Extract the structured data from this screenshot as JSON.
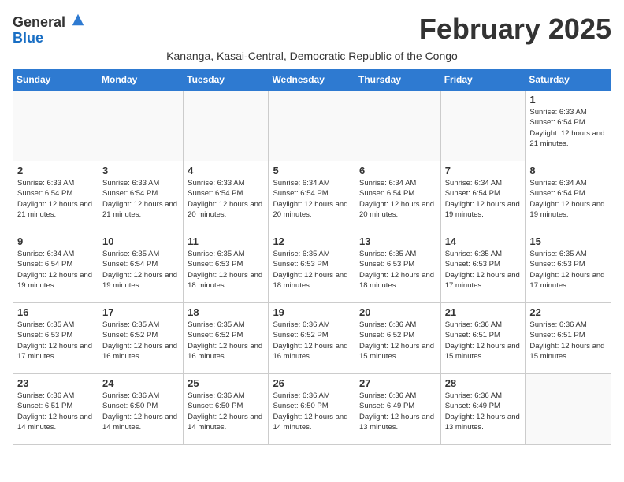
{
  "logo": {
    "general": "General",
    "blue": "Blue"
  },
  "header": {
    "month": "February 2025",
    "location": "Kananga, Kasai-Central, Democratic Republic of the Congo"
  },
  "days_of_week": [
    "Sunday",
    "Monday",
    "Tuesday",
    "Wednesday",
    "Thursday",
    "Friday",
    "Saturday"
  ],
  "weeks": [
    [
      {
        "day": "",
        "info": ""
      },
      {
        "day": "",
        "info": ""
      },
      {
        "day": "",
        "info": ""
      },
      {
        "day": "",
        "info": ""
      },
      {
        "day": "",
        "info": ""
      },
      {
        "day": "",
        "info": ""
      },
      {
        "day": "1",
        "info": "Sunrise: 6:33 AM\nSunset: 6:54 PM\nDaylight: 12 hours and 21 minutes."
      }
    ],
    [
      {
        "day": "2",
        "info": "Sunrise: 6:33 AM\nSunset: 6:54 PM\nDaylight: 12 hours and 21 minutes."
      },
      {
        "day": "3",
        "info": "Sunrise: 6:33 AM\nSunset: 6:54 PM\nDaylight: 12 hours and 21 minutes."
      },
      {
        "day": "4",
        "info": "Sunrise: 6:33 AM\nSunset: 6:54 PM\nDaylight: 12 hours and 20 minutes."
      },
      {
        "day": "5",
        "info": "Sunrise: 6:34 AM\nSunset: 6:54 PM\nDaylight: 12 hours and 20 minutes."
      },
      {
        "day": "6",
        "info": "Sunrise: 6:34 AM\nSunset: 6:54 PM\nDaylight: 12 hours and 20 minutes."
      },
      {
        "day": "7",
        "info": "Sunrise: 6:34 AM\nSunset: 6:54 PM\nDaylight: 12 hours and 19 minutes."
      },
      {
        "day": "8",
        "info": "Sunrise: 6:34 AM\nSunset: 6:54 PM\nDaylight: 12 hours and 19 minutes."
      }
    ],
    [
      {
        "day": "9",
        "info": "Sunrise: 6:34 AM\nSunset: 6:54 PM\nDaylight: 12 hours and 19 minutes."
      },
      {
        "day": "10",
        "info": "Sunrise: 6:35 AM\nSunset: 6:54 PM\nDaylight: 12 hours and 19 minutes."
      },
      {
        "day": "11",
        "info": "Sunrise: 6:35 AM\nSunset: 6:53 PM\nDaylight: 12 hours and 18 minutes."
      },
      {
        "day": "12",
        "info": "Sunrise: 6:35 AM\nSunset: 6:53 PM\nDaylight: 12 hours and 18 minutes."
      },
      {
        "day": "13",
        "info": "Sunrise: 6:35 AM\nSunset: 6:53 PM\nDaylight: 12 hours and 18 minutes."
      },
      {
        "day": "14",
        "info": "Sunrise: 6:35 AM\nSunset: 6:53 PM\nDaylight: 12 hours and 17 minutes."
      },
      {
        "day": "15",
        "info": "Sunrise: 6:35 AM\nSunset: 6:53 PM\nDaylight: 12 hours and 17 minutes."
      }
    ],
    [
      {
        "day": "16",
        "info": "Sunrise: 6:35 AM\nSunset: 6:53 PM\nDaylight: 12 hours and 17 minutes."
      },
      {
        "day": "17",
        "info": "Sunrise: 6:35 AM\nSunset: 6:52 PM\nDaylight: 12 hours and 16 minutes."
      },
      {
        "day": "18",
        "info": "Sunrise: 6:35 AM\nSunset: 6:52 PM\nDaylight: 12 hours and 16 minutes."
      },
      {
        "day": "19",
        "info": "Sunrise: 6:36 AM\nSunset: 6:52 PM\nDaylight: 12 hours and 16 minutes."
      },
      {
        "day": "20",
        "info": "Sunrise: 6:36 AM\nSunset: 6:52 PM\nDaylight: 12 hours and 15 minutes."
      },
      {
        "day": "21",
        "info": "Sunrise: 6:36 AM\nSunset: 6:51 PM\nDaylight: 12 hours and 15 minutes."
      },
      {
        "day": "22",
        "info": "Sunrise: 6:36 AM\nSunset: 6:51 PM\nDaylight: 12 hours and 15 minutes."
      }
    ],
    [
      {
        "day": "23",
        "info": "Sunrise: 6:36 AM\nSunset: 6:51 PM\nDaylight: 12 hours and 14 minutes."
      },
      {
        "day": "24",
        "info": "Sunrise: 6:36 AM\nSunset: 6:50 PM\nDaylight: 12 hours and 14 minutes."
      },
      {
        "day": "25",
        "info": "Sunrise: 6:36 AM\nSunset: 6:50 PM\nDaylight: 12 hours and 14 minutes."
      },
      {
        "day": "26",
        "info": "Sunrise: 6:36 AM\nSunset: 6:50 PM\nDaylight: 12 hours and 14 minutes."
      },
      {
        "day": "27",
        "info": "Sunrise: 6:36 AM\nSunset: 6:49 PM\nDaylight: 12 hours and 13 minutes."
      },
      {
        "day": "28",
        "info": "Sunrise: 6:36 AM\nSunset: 6:49 PM\nDaylight: 12 hours and 13 minutes."
      },
      {
        "day": "",
        "info": ""
      }
    ]
  ]
}
